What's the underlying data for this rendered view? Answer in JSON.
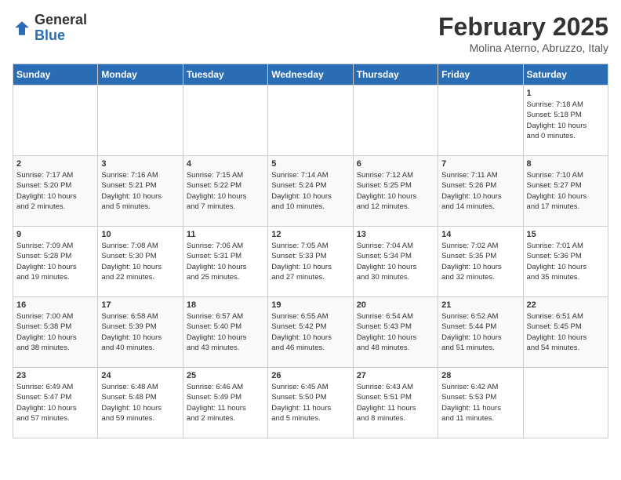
{
  "logo": {
    "general": "General",
    "blue": "Blue"
  },
  "title": "February 2025",
  "subtitle": "Molina Aterno, Abruzzo, Italy",
  "days_of_week": [
    "Sunday",
    "Monday",
    "Tuesday",
    "Wednesday",
    "Thursday",
    "Friday",
    "Saturday"
  ],
  "weeks": [
    [
      {
        "num": "",
        "info": ""
      },
      {
        "num": "",
        "info": ""
      },
      {
        "num": "",
        "info": ""
      },
      {
        "num": "",
        "info": ""
      },
      {
        "num": "",
        "info": ""
      },
      {
        "num": "",
        "info": ""
      },
      {
        "num": "1",
        "info": "Sunrise: 7:18 AM\nSunset: 5:18 PM\nDaylight: 10 hours\nand 0 minutes."
      }
    ],
    [
      {
        "num": "2",
        "info": "Sunrise: 7:17 AM\nSunset: 5:20 PM\nDaylight: 10 hours\nand 2 minutes."
      },
      {
        "num": "3",
        "info": "Sunrise: 7:16 AM\nSunset: 5:21 PM\nDaylight: 10 hours\nand 5 minutes."
      },
      {
        "num": "4",
        "info": "Sunrise: 7:15 AM\nSunset: 5:22 PM\nDaylight: 10 hours\nand 7 minutes."
      },
      {
        "num": "5",
        "info": "Sunrise: 7:14 AM\nSunset: 5:24 PM\nDaylight: 10 hours\nand 10 minutes."
      },
      {
        "num": "6",
        "info": "Sunrise: 7:12 AM\nSunset: 5:25 PM\nDaylight: 10 hours\nand 12 minutes."
      },
      {
        "num": "7",
        "info": "Sunrise: 7:11 AM\nSunset: 5:26 PM\nDaylight: 10 hours\nand 14 minutes."
      },
      {
        "num": "8",
        "info": "Sunrise: 7:10 AM\nSunset: 5:27 PM\nDaylight: 10 hours\nand 17 minutes."
      }
    ],
    [
      {
        "num": "9",
        "info": "Sunrise: 7:09 AM\nSunset: 5:28 PM\nDaylight: 10 hours\nand 19 minutes."
      },
      {
        "num": "10",
        "info": "Sunrise: 7:08 AM\nSunset: 5:30 PM\nDaylight: 10 hours\nand 22 minutes."
      },
      {
        "num": "11",
        "info": "Sunrise: 7:06 AM\nSunset: 5:31 PM\nDaylight: 10 hours\nand 25 minutes."
      },
      {
        "num": "12",
        "info": "Sunrise: 7:05 AM\nSunset: 5:33 PM\nDaylight: 10 hours\nand 27 minutes."
      },
      {
        "num": "13",
        "info": "Sunrise: 7:04 AM\nSunset: 5:34 PM\nDaylight: 10 hours\nand 30 minutes."
      },
      {
        "num": "14",
        "info": "Sunrise: 7:02 AM\nSunset: 5:35 PM\nDaylight: 10 hours\nand 32 minutes."
      },
      {
        "num": "15",
        "info": "Sunrise: 7:01 AM\nSunset: 5:36 PM\nDaylight: 10 hours\nand 35 minutes."
      }
    ],
    [
      {
        "num": "16",
        "info": "Sunrise: 7:00 AM\nSunset: 5:38 PM\nDaylight: 10 hours\nand 38 minutes."
      },
      {
        "num": "17",
        "info": "Sunrise: 6:58 AM\nSunset: 5:39 PM\nDaylight: 10 hours\nand 40 minutes."
      },
      {
        "num": "18",
        "info": "Sunrise: 6:57 AM\nSunset: 5:40 PM\nDaylight: 10 hours\nand 43 minutes."
      },
      {
        "num": "19",
        "info": "Sunrise: 6:55 AM\nSunset: 5:42 PM\nDaylight: 10 hours\nand 46 minutes."
      },
      {
        "num": "20",
        "info": "Sunrise: 6:54 AM\nSunset: 5:43 PM\nDaylight: 10 hours\nand 48 minutes."
      },
      {
        "num": "21",
        "info": "Sunrise: 6:52 AM\nSunset: 5:44 PM\nDaylight: 10 hours\nand 51 minutes."
      },
      {
        "num": "22",
        "info": "Sunrise: 6:51 AM\nSunset: 5:45 PM\nDaylight: 10 hours\nand 54 minutes."
      }
    ],
    [
      {
        "num": "23",
        "info": "Sunrise: 6:49 AM\nSunset: 5:47 PM\nDaylight: 10 hours\nand 57 minutes."
      },
      {
        "num": "24",
        "info": "Sunrise: 6:48 AM\nSunset: 5:48 PM\nDaylight: 10 hours\nand 59 minutes."
      },
      {
        "num": "25",
        "info": "Sunrise: 6:46 AM\nSunset: 5:49 PM\nDaylight: 11 hours\nand 2 minutes."
      },
      {
        "num": "26",
        "info": "Sunrise: 6:45 AM\nSunset: 5:50 PM\nDaylight: 11 hours\nand 5 minutes."
      },
      {
        "num": "27",
        "info": "Sunrise: 6:43 AM\nSunset: 5:51 PM\nDaylight: 11 hours\nand 8 minutes."
      },
      {
        "num": "28",
        "info": "Sunrise: 6:42 AM\nSunset: 5:53 PM\nDaylight: 11 hours\nand 11 minutes."
      },
      {
        "num": "",
        "info": ""
      }
    ]
  ]
}
